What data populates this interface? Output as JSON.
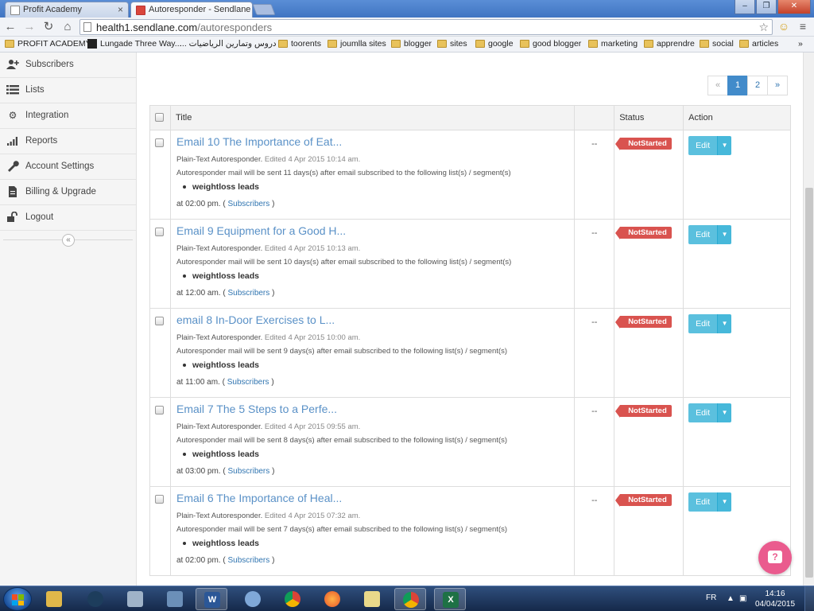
{
  "browser": {
    "tabs": [
      {
        "label": "Profit Academy"
      },
      {
        "label": "Autoresponder - Sendlane"
      }
    ],
    "url_host": "health1.sendlane.com",
    "url_path": "/autoresponders",
    "bookmarks": [
      "PROFIT ACADEMY",
      "Lungade Three Way...",
      "دروس وتمارين الرياضيات ...",
      "toorents",
      "joumlla sites",
      "blogger",
      "sites",
      "google",
      "good blogger",
      "marketing",
      "apprendre",
      "social",
      "articles"
    ],
    "bookmarks_more": "»"
  },
  "sidebar": {
    "items": [
      {
        "label": "Subscribers",
        "icon": "add-user-icon"
      },
      {
        "label": "Lists",
        "icon": "list-icon"
      },
      {
        "label": "Integration",
        "icon": "gear-icon"
      },
      {
        "label": "Reports",
        "icon": "signal-bars-icon"
      },
      {
        "label": "Account Settings",
        "icon": "wrench-icon"
      },
      {
        "label": "Billing & Upgrade",
        "icon": "document-icon"
      },
      {
        "label": "Logout",
        "icon": "unlock-icon"
      }
    ],
    "collapse_glyph": "«"
  },
  "pagination": {
    "prev": "«",
    "pages": [
      "1",
      "2"
    ],
    "current": "1",
    "next": "»"
  },
  "table": {
    "headers": {
      "title": "Title",
      "extra": "",
      "status": "Status",
      "action": "Action"
    },
    "rows": [
      {
        "title": "Email 10 The Importance of Eat...",
        "type": "Plain-Text Autoresponder.",
        "edited": "Edited 4 Apr 2015 10:14 am.",
        "description": "Autoresponder mail will be sent 11 days(s) after email subscribed to the following list(s) / segment(s)",
        "list": "weightloss leads",
        "time": "at 02:00 pm. (",
        "subscribers": "Subscribers",
        "time_close": ")",
        "extra": "--",
        "status": "NotStarted",
        "action": "Edit"
      },
      {
        "title": "Email 9 Equipment for a Good H...",
        "type": "Plain-Text Autoresponder.",
        "edited": "Edited 4 Apr 2015 10:13 am.",
        "description": "Autoresponder mail will be sent 10 days(s) after email subscribed to the following list(s) / segment(s)",
        "list": "weightloss leads",
        "time": "at 12:00 am. (",
        "subscribers": "Subscribers",
        "time_close": ")",
        "extra": "--",
        "status": "NotStarted",
        "action": "Edit"
      },
      {
        "title": "email 8 In-Door Exercises to L...",
        "type": "Plain-Text Autoresponder.",
        "edited": "Edited 4 Apr 2015 10:00 am.",
        "description": "Autoresponder mail will be sent 9 days(s) after email subscribed to the following list(s) / segment(s)",
        "list": "weightloss leads",
        "time": "at 11:00 am. (",
        "subscribers": "Subscribers",
        "time_close": ")",
        "extra": "--",
        "status": "NotStarted",
        "action": "Edit"
      },
      {
        "title": "Email 7 The 5 Steps to a Perfe...",
        "type": "Plain-Text Autoresponder.",
        "edited": "Edited 4 Apr 2015 09:55 am.",
        "description": "Autoresponder mail will be sent 8 days(s) after email subscribed to the following list(s) / segment(s)",
        "list": "weightloss leads",
        "time": "at 03:00 pm. (",
        "subscribers": "Subscribers",
        "time_close": ")",
        "extra": "--",
        "status": "NotStarted",
        "action": "Edit"
      },
      {
        "title": "Email 6 The Importance of Heal...",
        "type": "Plain-Text Autoresponder.",
        "edited": "Edited 4 Apr 2015 07:32 am.",
        "description": "Autoresponder mail will be sent 7 days(s) after email subscribed to the following list(s) / segment(s)",
        "list": "weightloss leads",
        "time": "at 02:00 pm. (",
        "subscribers": "Subscribers",
        "time_close": ")",
        "extra": "--",
        "status": "NotStarted",
        "action": "Edit"
      }
    ]
  },
  "taskbar": {
    "language": "FR",
    "time": "14:16",
    "date": "04/04/2015"
  },
  "colors": {
    "accent": "#428bca",
    "link": "#5a91c7",
    "status_danger": "#d9534f",
    "edit_button": "#5bc0de",
    "help_button": "#ea5b8e"
  }
}
